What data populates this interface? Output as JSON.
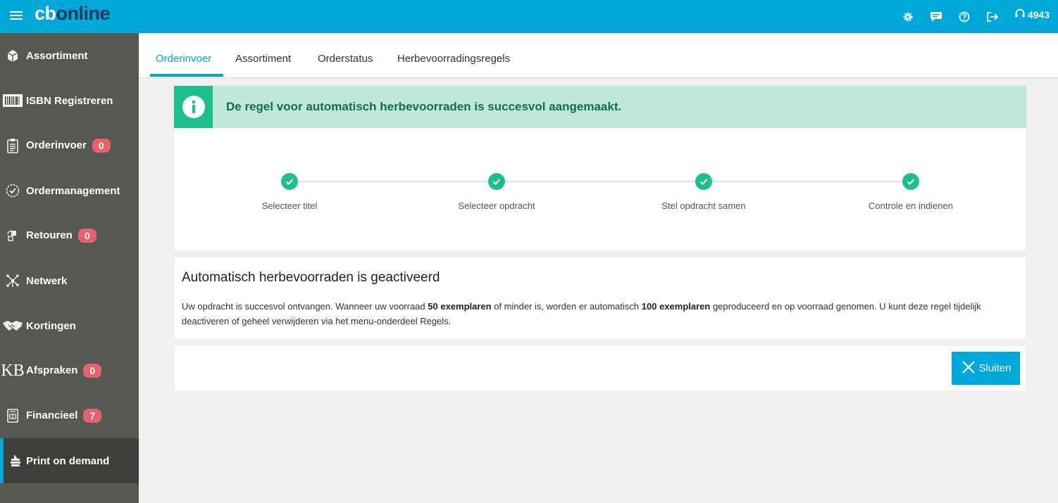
{
  "header": {
    "logo_cb": "cb",
    "logo_online": "online",
    "support_number": "4943",
    "icons": [
      "menu-icon",
      "gear-icon",
      "chat-icon",
      "help-icon",
      "logout-icon",
      "headset-icon"
    ]
  },
  "sidebar": {
    "items": [
      {
        "label": "Assortiment",
        "badge": null,
        "icon": "box-icon"
      },
      {
        "label": "ISBN Registreren",
        "badge": null,
        "icon": "barcode-icon"
      },
      {
        "label": "Orderinvoer",
        "badge": "0",
        "icon": "clipboard-icon"
      },
      {
        "label": "Ordermanagement",
        "badge": null,
        "icon": "check-circle-icon"
      },
      {
        "label": "Retouren",
        "badge": "0",
        "icon": "return-icon"
      },
      {
        "label": "Netwerk",
        "badge": null,
        "icon": "network-icon"
      },
      {
        "label": "Kortingen",
        "badge": null,
        "icon": "handshake-icon"
      },
      {
        "label": "Afspraken",
        "badge": "0",
        "icon": "kb-icon",
        "icon_text": "KB"
      },
      {
        "label": "Financieel",
        "badge": "7",
        "icon": "invoice-icon"
      },
      {
        "label": "Print on demand",
        "badge": null,
        "icon": "print-icon",
        "active": true
      }
    ]
  },
  "tabs": [
    {
      "label": "Orderinvoer",
      "active": true
    },
    {
      "label": "Assortiment"
    },
    {
      "label": "Orderstatus"
    },
    {
      "label": "Herbevoorradingsregels"
    }
  ],
  "alert": {
    "text": "De regel voor automatisch herbevoorraden is succesvol aangemaakt."
  },
  "steps": [
    {
      "label": "Selecteer titel",
      "done": true
    },
    {
      "label": "Selecteer opdracht",
      "done": true
    },
    {
      "label": "Stel opdracht samen",
      "done": true
    },
    {
      "label": "Controle en indienen",
      "done": true
    }
  ],
  "info": {
    "title": "Automatisch herbevoorraden is geactiveerd",
    "body_part1": "Uw opdracht is succesvol ontvangen. Wanneer uw voorraad ",
    "body_bold1": "50 exemplaren",
    "body_part2": " of minder is, worden er automatisch ",
    "body_bold2": "100 exemplaren",
    "body_part3": " geproduceerd en op voorraad genomen. U kunt deze regel tijdelijk deactiveren of geheel verwijderen via het menu-onderdeel Regels."
  },
  "footer": {
    "close_label": "Sluiten"
  },
  "colors": {
    "brand": "#00a7d9",
    "sidebar": "#585853",
    "success": "#1ebf8f",
    "success_bg": "#bfe8da",
    "badge": "#e8626e"
  }
}
